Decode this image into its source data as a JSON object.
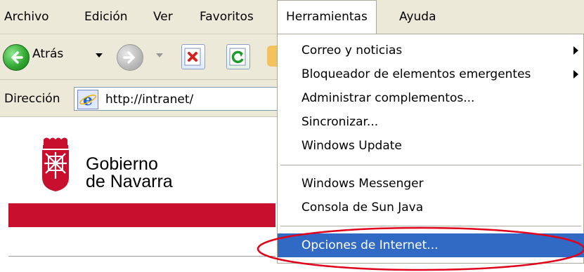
{
  "menubar": {
    "items": [
      "Archivo",
      "Edición",
      "Ver",
      "Favoritos",
      "Herramientas",
      "Ayuda"
    ],
    "active_index": 4
  },
  "toolbar": {
    "back_label": "Atrás"
  },
  "address": {
    "label": "Dirección",
    "url": "http://intranet/"
  },
  "page": {
    "org_name_line1": "Gobierno",
    "org_name_line2": "de Navarra",
    "brand_color": "#c8102e"
  },
  "tools_menu": {
    "items": [
      {
        "label": "Correo y noticias",
        "has_submenu": true
      },
      {
        "label": "Bloqueador de elementos emergentes",
        "has_submenu": true
      },
      {
        "label": "Administrar complementos...",
        "has_submenu": false
      },
      {
        "label": "Sincronizar...",
        "has_submenu": false
      },
      {
        "label": "Windows Update",
        "has_submenu": false
      },
      {
        "label": "Windows Messenger",
        "has_submenu": false
      },
      {
        "label": "Consola de Sun Java",
        "has_submenu": false
      },
      {
        "label": "Opciones de Internet...",
        "has_submenu": false,
        "highlighted": true
      }
    ],
    "highlight_color": "#316ac5",
    "annotation_color": "#e0001a"
  }
}
